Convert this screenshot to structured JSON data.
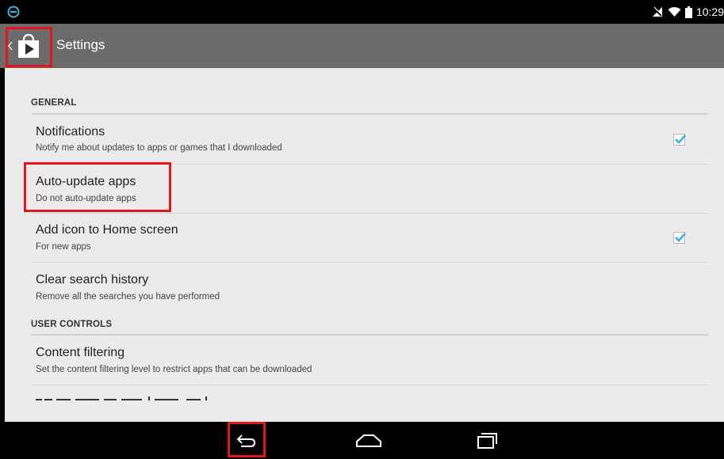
{
  "status_bar": {
    "time": "10:29",
    "icons": [
      "app-notification-icon",
      "signal-muted-icon",
      "wifi-icon",
      "battery-icon"
    ]
  },
  "action_bar": {
    "title": "Settings",
    "icon": "play-store-icon",
    "up": "back-chevron-icon",
    "bg_color": "#6b6b6b"
  },
  "sections": [
    {
      "header": "GENERAL"
    },
    {
      "header": "USER CONTROLS"
    }
  ],
  "settings": [
    {
      "title": "Notifications",
      "summary": "Notify me about updates to apps or games that I downloaded",
      "checked": true
    },
    {
      "title": "Auto-update apps",
      "summary": "Do not auto-update apps"
    },
    {
      "title": "Add icon to Home screen",
      "summary": "For new apps",
      "checked": true
    },
    {
      "title": "Clear search history",
      "summary": "Remove all the searches you have performed"
    },
    {
      "title": "Content filtering",
      "summary": "Set the content filtering level to restrict apps that can be downloaded"
    }
  ],
  "nav_bar": {
    "buttons": [
      "back-icon",
      "home-icon",
      "recent-apps-icon"
    ]
  },
  "colors": {
    "highlight": "#e3161b",
    "checkbox_check": "#33b5e5",
    "content_bg": "#ebebeb"
  }
}
